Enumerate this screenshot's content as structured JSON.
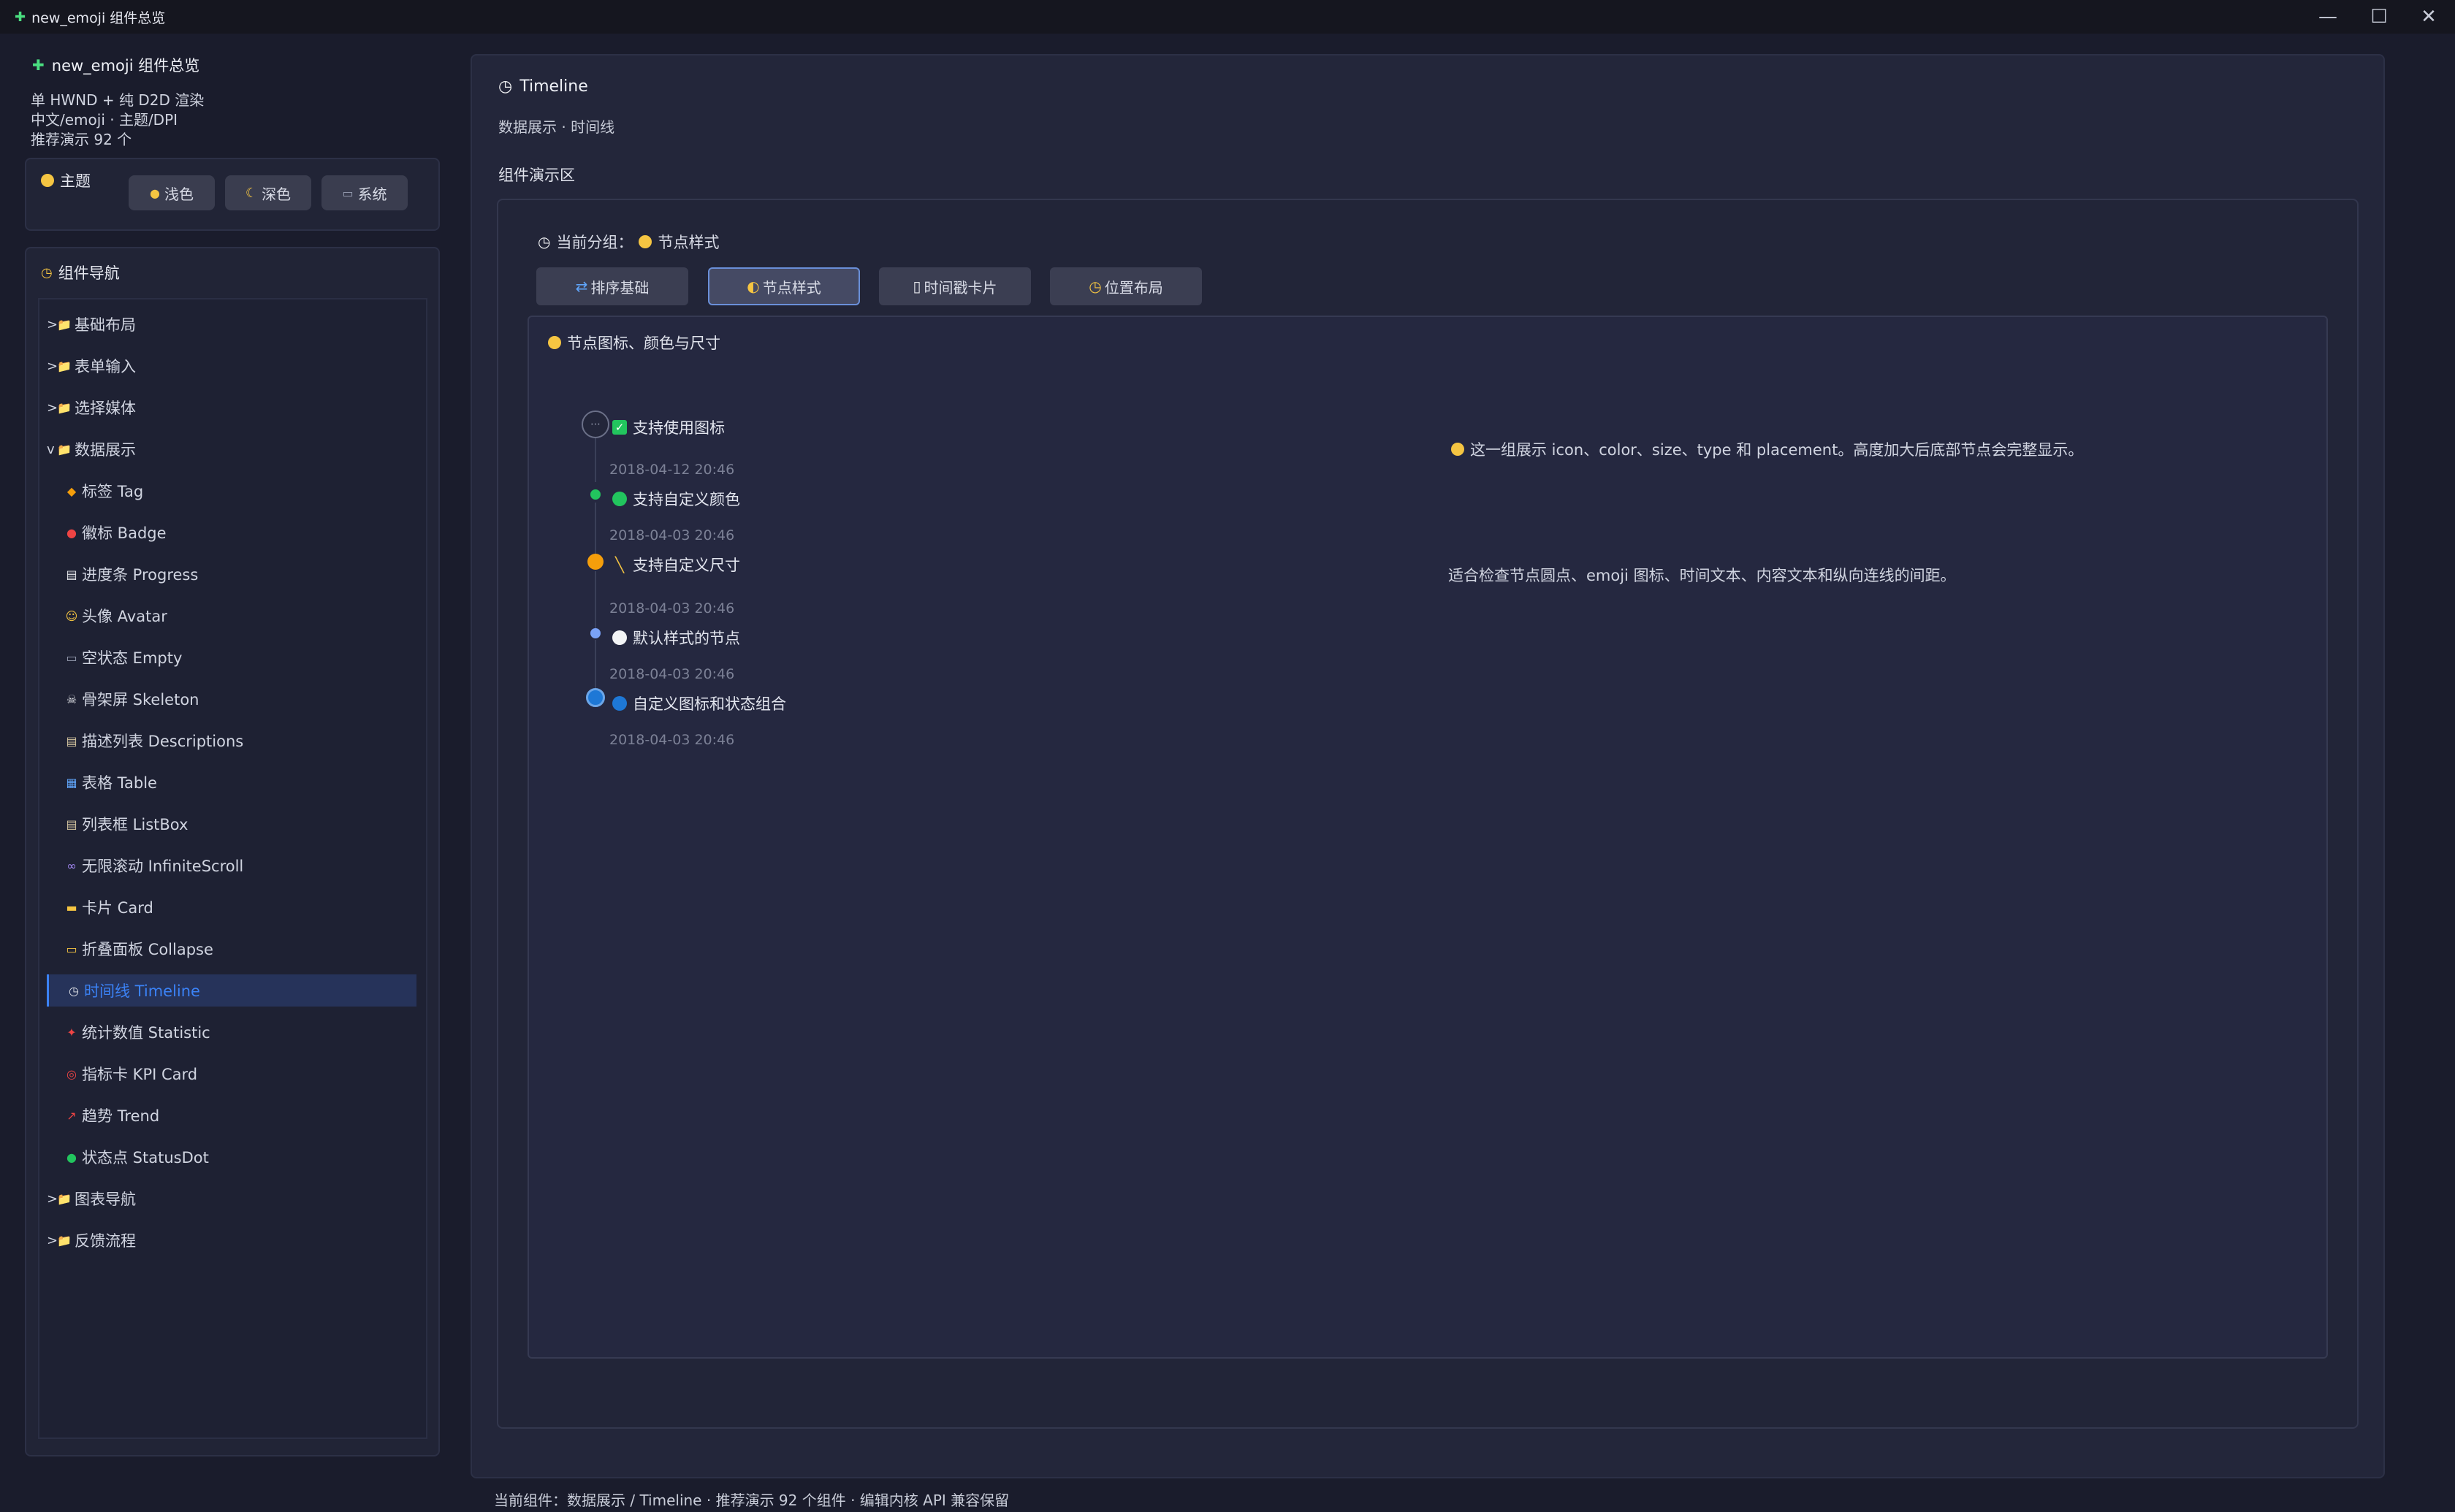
{
  "window": {
    "title": "new_emoji 组件总览",
    "controls": {
      "minimize": "—",
      "maximize": "☐",
      "close": "✕"
    }
  },
  "app": {
    "header": "new_emoji 组件总览",
    "info": [
      "单 HWND + 纯 D2D 渲染",
      "中文/emoji · 主题/DPI",
      "推荐演示 92 个"
    ]
  },
  "theme": {
    "title": "主题",
    "buttons": [
      {
        "icon": "●",
        "label": "浅色"
      },
      {
        "icon": "☾",
        "label": "深色"
      },
      {
        "icon": "▭",
        "label": "系统"
      }
    ]
  },
  "nav": {
    "title": "组件导航",
    "items": [
      {
        "label": "基础布局",
        "caret": ">",
        "icon": "📁"
      },
      {
        "label": "表单输入",
        "caret": ">",
        "icon": "📁"
      },
      {
        "label": "选择媒体",
        "caret": ">",
        "icon": "📁"
      },
      {
        "label": "数据展示",
        "caret": "v",
        "icon": "📁"
      },
      {
        "label": "标签 Tag",
        "icon": "◆"
      },
      {
        "label": "徽标 Badge",
        "icon": "●"
      },
      {
        "label": "进度条 Progress",
        "icon": "▤"
      },
      {
        "label": "头像 Avatar",
        "icon": "☺"
      },
      {
        "label": "空状态 Empty",
        "icon": "▭"
      },
      {
        "label": "骨架屏 Skeleton",
        "icon": "☠"
      },
      {
        "label": "描述列表 Descriptions",
        "icon": "▤"
      },
      {
        "label": "表格 Table",
        "icon": "▦"
      },
      {
        "label": "列表框 ListBox",
        "icon": "▤"
      },
      {
        "label": "无限滚动 InfiniteScroll",
        "icon": "∞"
      },
      {
        "label": "卡片 Card",
        "icon": "▬"
      },
      {
        "label": "折叠面板 Collapse",
        "icon": "▭"
      },
      {
        "label": "时间线 Timeline",
        "icon": "◷"
      },
      {
        "label": "统计数值 Statistic",
        "icon": "✦"
      },
      {
        "label": "指标卡 KPI Card",
        "icon": "◎"
      },
      {
        "label": "趋势 Trend",
        "icon": "↗"
      },
      {
        "label": "状态点 StatusDot",
        "icon": "●"
      },
      {
        "label": "图表导航",
        "caret": ">",
        "icon": "📁"
      },
      {
        "label": "反馈流程",
        "caret": ">",
        "icon": "📁"
      }
    ]
  },
  "main": {
    "title": "Timeline",
    "subtitle": "数据展示 · 时间线",
    "demo_label": "组件演示区",
    "group_prefix": "当前分组：",
    "group_name": "节点样式",
    "tabs": [
      {
        "icon": "⇄",
        "label": "排序基础"
      },
      {
        "icon": "◐",
        "label": "节点样式"
      },
      {
        "icon": "▯",
        "label": "时间戳卡片"
      },
      {
        "icon": "◷",
        "label": "位置布局"
      }
    ],
    "card_title": "节点图标、颜色与尺寸",
    "timeline": [
      {
        "content": "支持使用图标",
        "time": "2018-04-12 20:46"
      },
      {
        "content": "支持自定义颜色",
        "time": "2018-04-03 20:46"
      },
      {
        "content": "支持自定义尺寸",
        "time": "2018-04-03 20:46"
      },
      {
        "content": "默认样式的节点",
        "time": "2018-04-03 20:46"
      },
      {
        "content": "自定义图标和状态组合",
        "time": "2018-04-03 20:46"
      }
    ],
    "notes": [
      "这一组展示 icon、color、size、type 和 placement。高度加大后底部节点会完整显示。",
      "适合检查节点圆点、emoji 图标、时间文本、内容文本和纵向连线的间距。"
    ],
    "status": "当前组件：数据展示 / Timeline · 推荐演示 92 个组件 · 编辑内核 API 兼容保留"
  },
  "colors": {
    "accent": "#3b82f6",
    "green": "#22c55e",
    "orange": "#f59e0b",
    "blue_light": "#7aa2f7",
    "blue": "#1e78d6",
    "emoji_yellow": "#f5c542"
  }
}
